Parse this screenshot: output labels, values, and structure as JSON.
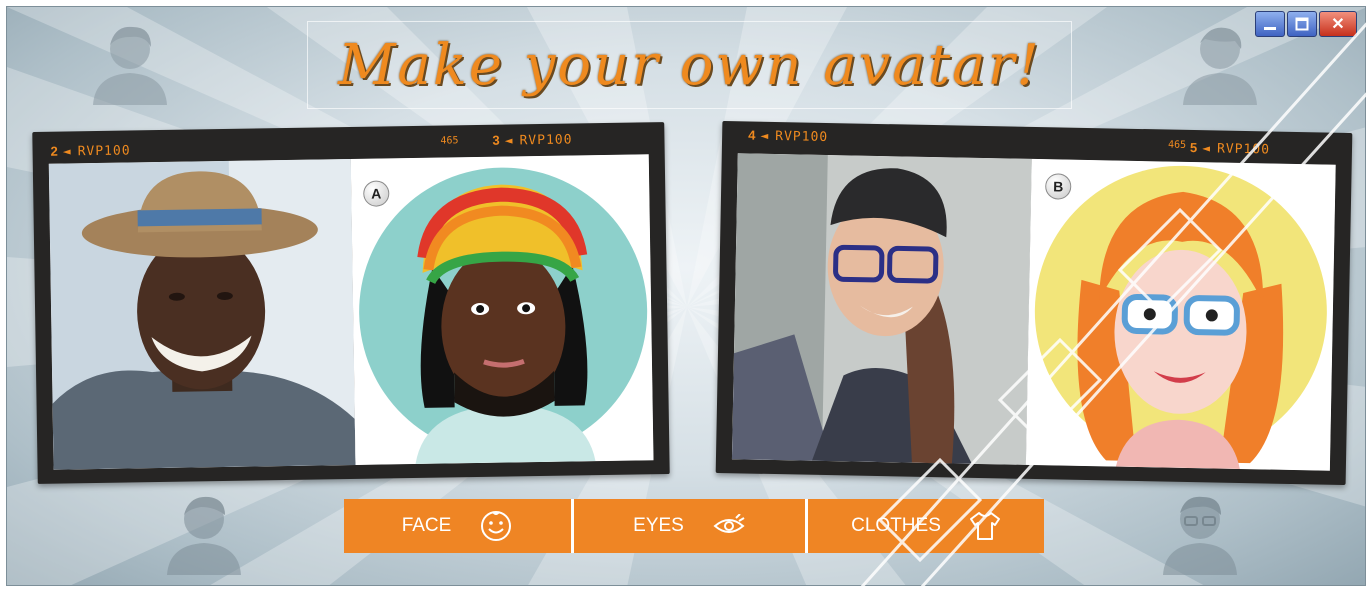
{
  "window": {
    "title": "Make your own avatar!",
    "controls": {
      "minimize": "minimize",
      "maximize": "maximize",
      "close": "✕"
    }
  },
  "strips": {
    "left": {
      "frame_a_label_num": "2",
      "frame_a_label": "RVP100",
      "small_number": "465",
      "frame_b_label_num": "3",
      "frame_b_label": "RVP100",
      "avatar_letter": "A"
    },
    "right": {
      "frame_a_label_num": "4",
      "frame_a_label": "RVP100",
      "small_number": "465",
      "frame_b_label_num": "5",
      "frame_b_label": "RVP100",
      "avatar_letter": "B"
    }
  },
  "menu": [
    {
      "label": "FACE",
      "icon": "smiley-face-icon"
    },
    {
      "label": "EYES",
      "icon": "eye-icon"
    },
    {
      "label": "CLOTHES",
      "icon": "t-shirt-icon"
    }
  ],
  "colors": {
    "accent": "#ef8524",
    "film": "#262524",
    "title": "#ef8a1f"
  }
}
